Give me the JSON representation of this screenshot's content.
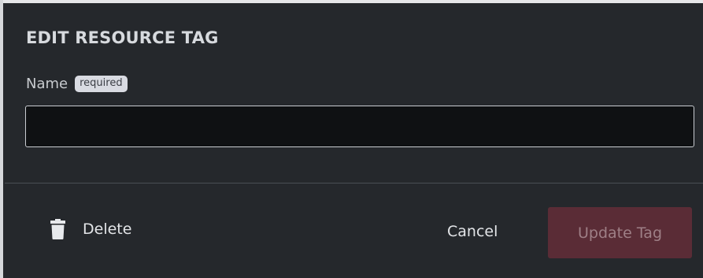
{
  "dialog": {
    "title": "EDIT RESOURCE TAG",
    "name_field": {
      "label": "Name",
      "badge": "required",
      "value": "",
      "placeholder": ""
    },
    "footer": {
      "delete_label": "Delete",
      "delete_icon": "trash-icon",
      "cancel_label": "Cancel",
      "update_label": "Update Tag",
      "update_disabled": true
    }
  },
  "colors": {
    "background": "#25282c",
    "input_background": "#0f1113",
    "primary_disabled": "#5a2c36",
    "primary_disabled_text": "#9e7f86",
    "text": "#d7dade"
  }
}
